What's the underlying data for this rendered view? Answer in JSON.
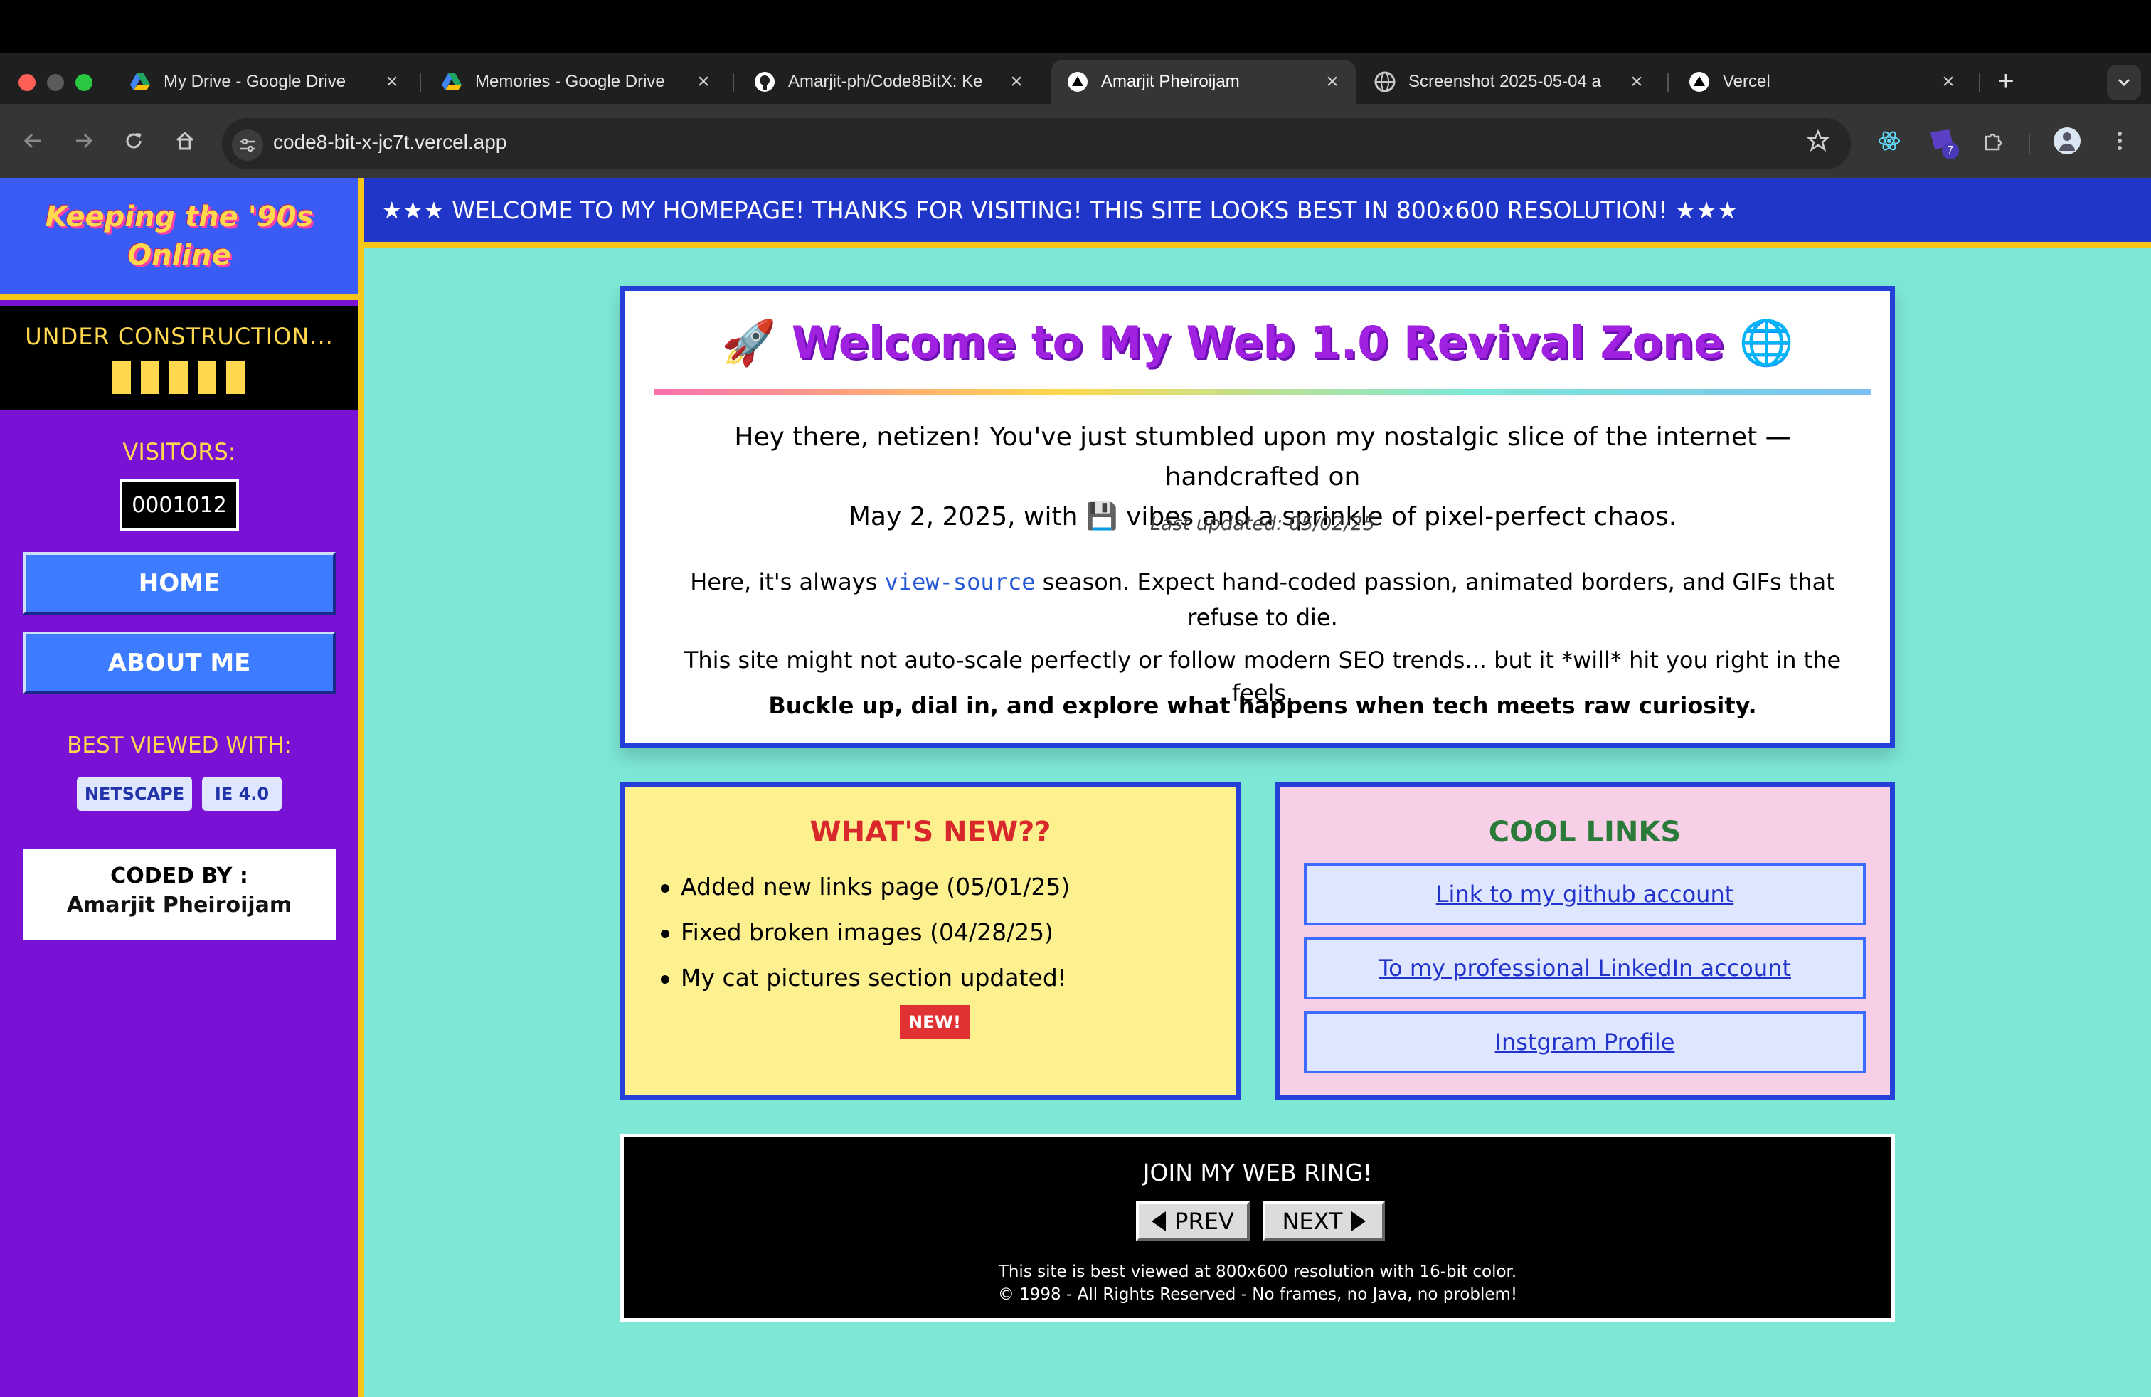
{
  "browser": {
    "tabs": [
      {
        "title": "My Drive - Google Drive",
        "icon": "google-drive-icon",
        "active": false
      },
      {
        "title": "Memories - Google Drive",
        "icon": "google-drive-icon",
        "active": false
      },
      {
        "title": "Amarjit-ph/Code8BitX: Ke",
        "icon": "github-icon",
        "active": false
      },
      {
        "title": "Amarjit Pheiroijam",
        "icon": "vercel-icon",
        "active": true
      },
      {
        "title": "Screenshot 2025-05-04 a",
        "icon": "globe-icon",
        "active": false
      },
      {
        "title": "Vercel",
        "icon": "vercel-icon",
        "active": false
      }
    ],
    "url": "code8-bit-x-jc7t.vercel.app",
    "extension_badge": "7"
  },
  "sidebar": {
    "logo_line1": "Keeping the '90s",
    "logo_line2": "Online",
    "under_construction": "UNDER CONSTRUCTION...",
    "visitors_label": "VISITORS:",
    "visitors_count": "0001012",
    "nav": [
      {
        "label": "HOME"
      },
      {
        "label": "ABOUT ME"
      }
    ],
    "best_viewed_label": "BEST VIEWED WITH:",
    "browsers": [
      "NETSCAPE",
      "IE 4.0"
    ],
    "coded_by_label": "CODED BY :",
    "coded_by_name": "Amarjit Pheiroijam"
  },
  "marquee": "★★★ WELCOME TO MY HOMEPAGE! THANKS FOR VISITING! THIS SITE LOOKS BEST IN 800x600 RESOLUTION! ★★★",
  "welcome": {
    "emoji_left": "🚀",
    "title": "Welcome to My Web 1.0 Revival Zone",
    "emoji_right": "🌐",
    "p1_line1": "Hey there, netizen! You've just stumbled upon my nostalgic slice of the internet — handcrafted on",
    "p1_line2": "May 2, 2025, with 💾 vibes and a sprinkle of pixel-perfect chaos.",
    "updated": "Last updated: 05/02/25",
    "p2_before": "Here, it's always ",
    "p2_code": "view-source",
    "p2_after": " season. Expect hand-coded passion, animated borders, and GIFs that refuse to die.",
    "p3": "This site might not auto-scale perfectly or follow modern SEO trends... but it *will* hit you right in the feels.",
    "p4": "Buckle up, dial in, and explore what happens when tech meets raw curiosity."
  },
  "news": {
    "title": "WHAT'S NEW??",
    "items": [
      "Added new links page (05/01/25)",
      "Fixed broken images (04/28/25)",
      "My cat pictures section updated!"
    ],
    "badge": "NEW!"
  },
  "links": {
    "title": "COOL LINKS",
    "items": [
      "Link to my github account",
      "To my professional LinkedIn account",
      "Instgram Profile"
    ]
  },
  "footer": {
    "webring": "JOIN MY WEB RING!",
    "prev": "PREV",
    "next": "NEXT",
    "line1": "This site is best viewed at 800x600 resolution with 16-bit color.",
    "line2": "© 1998 - All Rights Reserved - No frames, no Java, no problem!"
  },
  "colors": {
    "page_bg": "#7ee8d6",
    "sidebar_bg": "#7a12d6",
    "accent_yellow": "#f5c518",
    "card_border": "#2440d8",
    "title_purple": "#a021e0"
  }
}
